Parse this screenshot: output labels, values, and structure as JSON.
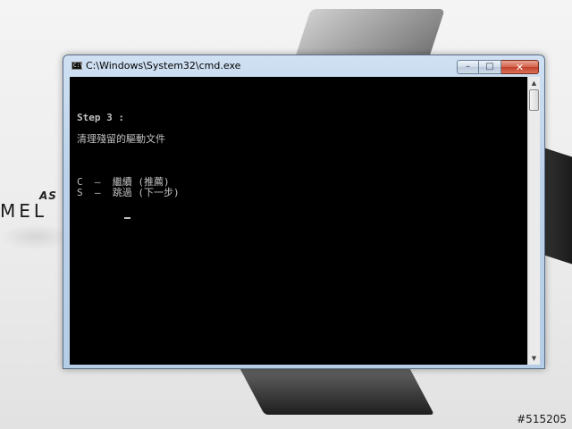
{
  "window": {
    "title": "C:\\Windows\\System32\\cmd.exe",
    "icon": "cmd-icon",
    "icon_text": "C:\\"
  },
  "caption_buttons": {
    "minimize": "–",
    "maximize": "□",
    "close": "✕"
  },
  "console": {
    "lines": [
      "Step 3 :",
      "",
      "清理殘留的驅動文件",
      "",
      "",
      "",
      "C  –  繼續 (推薦)",
      "S  –  跳過 (下一步)"
    ],
    "background": "#000000",
    "foreground": "#c0c0c0"
  },
  "scrollbar": {
    "up_arrow": "▲",
    "down_arrow": "▼"
  },
  "wallpaper": {
    "brand_small": "AS",
    "brand_big": "MEL",
    "watermark": "#515205"
  }
}
